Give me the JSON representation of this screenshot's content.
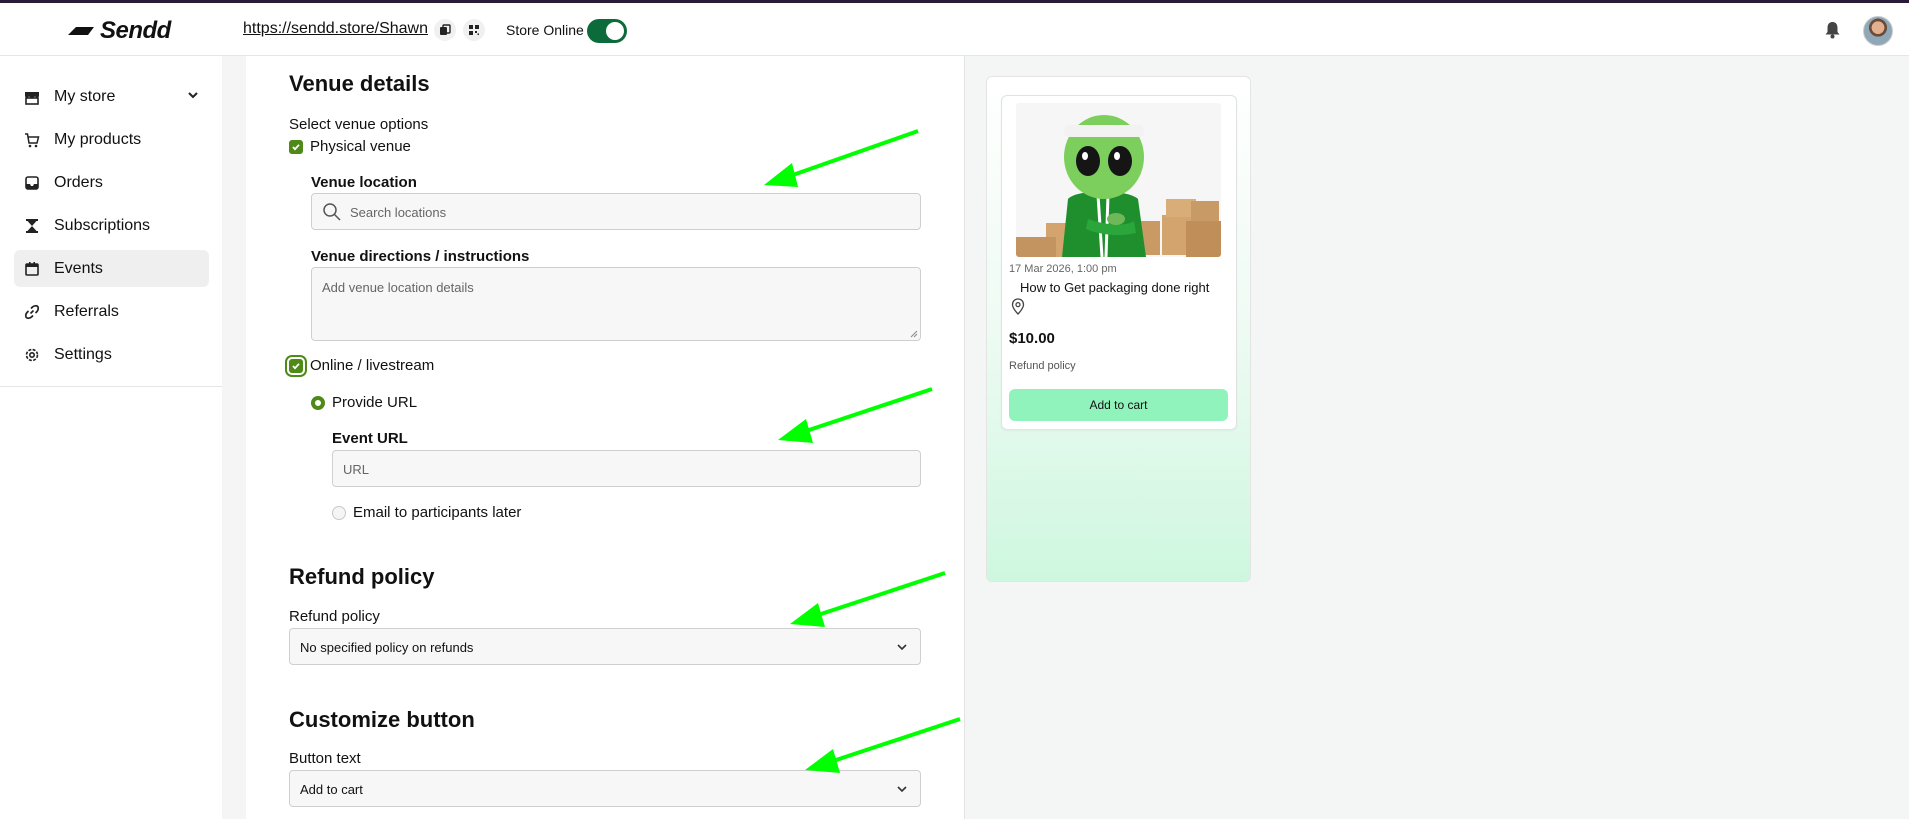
{
  "app": {
    "logo_text": "Sendd",
    "store_url": "https://sendd.store/Shawn",
    "store_status_label": "Store Online",
    "store_online": true
  },
  "sidebar": {
    "items": [
      {
        "label": "My store",
        "icon": "store-icon",
        "has_chevron": true
      },
      {
        "label": "My products",
        "icon": "cart-icon"
      },
      {
        "label": "Orders",
        "icon": "inbox-icon"
      },
      {
        "label": "Subscriptions",
        "icon": "hourglass-icon"
      },
      {
        "label": "Events",
        "icon": "calendar-icon",
        "active": true
      },
      {
        "label": "Referrals",
        "icon": "link-icon"
      },
      {
        "label": "Settings",
        "icon": "gear-icon"
      }
    ]
  },
  "venue": {
    "heading": "Venue details",
    "options_label": "Select venue options",
    "physical_label": "Physical venue",
    "physical_checked": true,
    "location_label": "Venue location",
    "location_placeholder": "Search locations",
    "directions_label": "Venue directions / instructions",
    "directions_placeholder": "Add venue location details",
    "online_label": "Online / livestream",
    "online_checked": true,
    "provide_url_label": "Provide URL",
    "provide_url_selected": true,
    "event_url_label": "Event URL",
    "event_url_placeholder": "URL",
    "email_later_label": "Email to participants later"
  },
  "refund": {
    "heading": "Refund policy",
    "label": "Refund policy",
    "selected": "No specified policy on refunds"
  },
  "customize": {
    "heading": "Customize button",
    "label": "Button text",
    "selected": "Add to cart"
  },
  "preview": {
    "date": "17 Mar 2026, 1:00 pm",
    "title": "How to Get packaging done right",
    "price": "$10.00",
    "refund_label": "Refund policy",
    "button_label": "Add to cart",
    "button_color": "#8ff3bb"
  },
  "colors": {
    "accent": "#4f8a18",
    "toggle": "#0b6b3a",
    "annotation_arrow": "#00ff00"
  }
}
